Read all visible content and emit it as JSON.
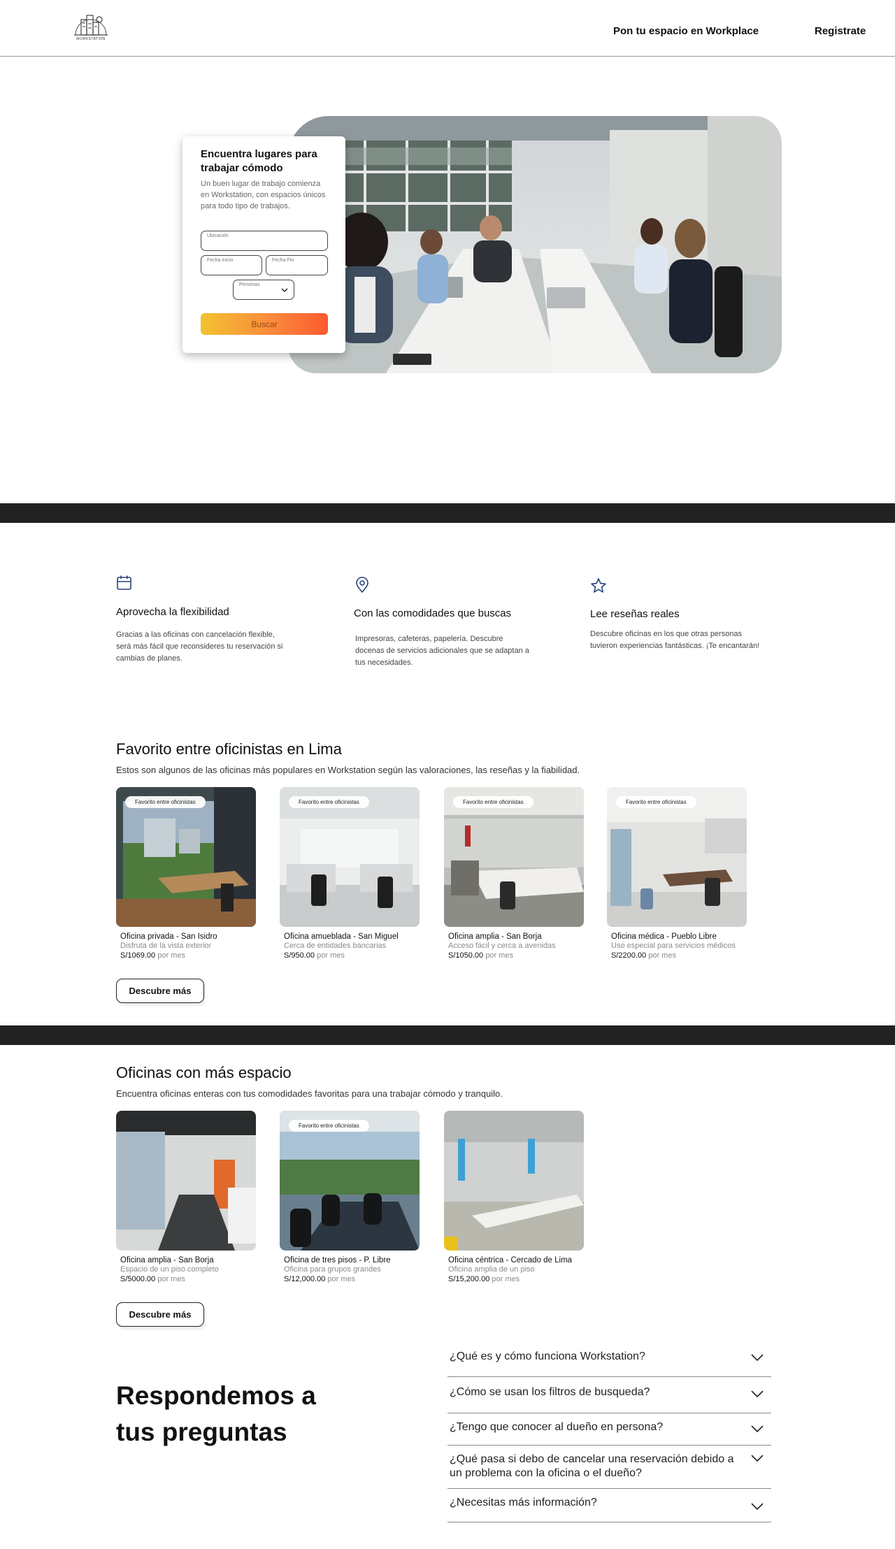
{
  "header": {
    "logo_text": "WORKSTATION",
    "nav_workplace": "Pon tu espacio en Workplace",
    "nav_register": "Registrate"
  },
  "hero": {
    "search": {
      "title": "Encuentra lugares para trabajar cómodo",
      "description": "Un buen lugar de trabajo comienza en Workstation, con espacios únicos para todo tipo de trabajos.",
      "location_label": "Ubicación",
      "start_label": "Fecha inicio",
      "end_label": "Fecha Fin",
      "people_label": "Personas",
      "button": "Buscar"
    }
  },
  "features": [
    {
      "icon": "calendar-icon",
      "title": "Aprovecha la flexibilidad",
      "desc": "Gracias a las oficinas con cancelación flexible, será más fácil que reconsideres tu reservación si cambias de planes."
    },
    {
      "icon": "location-pin-icon",
      "title": "Con las comodidades que buscas",
      "desc": "Impresoras, cafeteras, papelería. Descubre docenas de servicios adicionales que se adaptan a tus necesidades."
    },
    {
      "icon": "star-icon",
      "title": "Lee reseñas reales",
      "desc": "Descubre oficinas en los que otras personas tuvieron experiencias fantásticas. ¡Te encantarán!"
    }
  ],
  "favorites": {
    "title": "Favorito entre oficinistas en Lima",
    "subtitle": "Estos son algunos de las oficinas más populares en Workstation según las valoraciones, las reseñas y la fiabilidad.",
    "badge": "Favorito entre oficinistas",
    "more": "Descubre más",
    "unit": "por mes",
    "cards": [
      {
        "name": "Oficina privada - San Isidro",
        "detail": "Disfruta de la vista exterior",
        "price": "S/1069.00"
      },
      {
        "name": "Oficina amueblada - San Miguel",
        "detail": "Cerca de entidades bancarias",
        "price": "S/950.00"
      },
      {
        "name": "Oficina amplia - San Borja",
        "detail": "Acceso fácil y cerca a avenidas",
        "price": "S/1050.00"
      },
      {
        "name": "Oficina médica - Pueblo Libre",
        "detail": "Uso especial para servicios médicos",
        "price": "S/2200.00"
      }
    ]
  },
  "spacious": {
    "title": "Oficinas con más espacio",
    "subtitle": "Encuentra oficinas enteras con tus comodidades favoritas para una trabajar cómodo y tranquilo.",
    "badge": "Favorito entre oficinistas",
    "more": "Descubre más",
    "unit": "por mes",
    "cards": [
      {
        "name": "Oficina amplia - San Borja",
        "detail": "Espacio de un piso completo",
        "price": "S/5000.00"
      },
      {
        "name": "Oficina de tres pisos - P. Libre",
        "detail": "Oficina para grupos grandes",
        "price": "S/12,000.00"
      },
      {
        "name": "Oficina céntrica - Cercado de Lima",
        "detail": "Oficina amplia de un piso",
        "price": "S/15,200.00"
      }
    ]
  },
  "faq": {
    "title": "Respondemos a tus preguntas",
    "questions": [
      "¿Qué es y cómo funciona Workstation?",
      "¿Cómo se usan los filtros de busqueda?",
      "¿Tengo que conocer al dueño en persona?",
      "¿Qué pasa si debo de cancelar una reservación debido a un problema con la oficina o el dueño?",
      "¿Necesitas más información?"
    ]
  }
}
